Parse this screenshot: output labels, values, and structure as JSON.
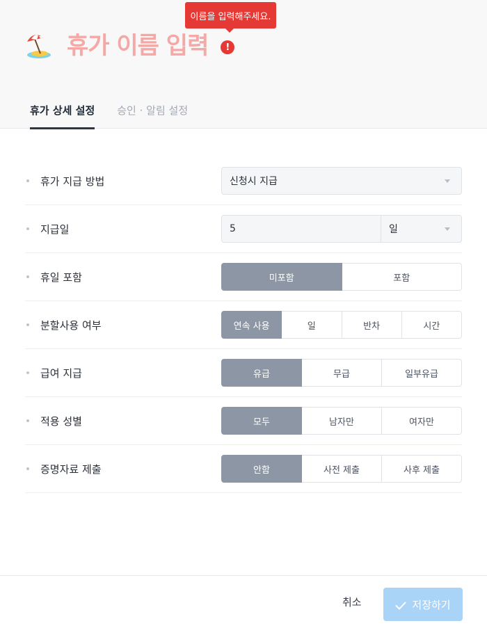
{
  "header": {
    "title": "휴가 이름 입력",
    "title_icon": "beach-umbrella-icon",
    "error_mark": "!",
    "tooltip": "이름을 입력해주세요."
  },
  "tabs": [
    {
      "label": "휴가 상세 설정",
      "active": true
    },
    {
      "label": "승인 · 알림 설정",
      "active": false
    }
  ],
  "form": {
    "rows": [
      {
        "label": "휴가 지급 방법",
        "type": "select",
        "value": "신청시 지급"
      },
      {
        "label": "지급일",
        "type": "number-unit",
        "value": "5",
        "unit": "일"
      },
      {
        "label": "휴일 포함",
        "type": "segment",
        "options": [
          "미포함",
          "포함"
        ],
        "selected": 0
      },
      {
        "label": "분할사용 여부",
        "type": "segment",
        "options": [
          "연속 사용",
          "일",
          "반차",
          "시간"
        ],
        "selected": 0
      },
      {
        "label": "급여 지급",
        "type": "segment",
        "options": [
          "유급",
          "무급",
          "일부유급"
        ],
        "selected": 0
      },
      {
        "label": "적용 성별",
        "type": "segment",
        "options": [
          "모두",
          "남자만",
          "여자만"
        ],
        "selected": 0
      },
      {
        "label": "증명자료 제출",
        "type": "segment",
        "options": [
          "안함",
          "사전 제출",
          "사후 제출"
        ],
        "selected": 0
      }
    ]
  },
  "footer": {
    "cancel_label": "취소",
    "save_label": "저장하기"
  },
  "colors": {
    "title": "#f4a9a6",
    "error": "#e53935",
    "selected_segment": "#8c96a5",
    "save_button": "#a9d4f7"
  }
}
